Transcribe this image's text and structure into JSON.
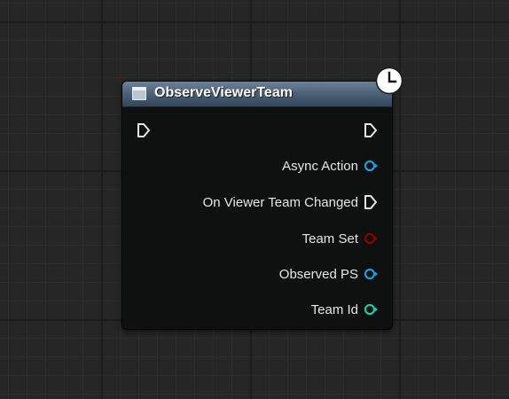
{
  "node": {
    "title": "ObserveViewerTeam",
    "is_latent": true,
    "header_color": "#4e6379",
    "pins": [
      {
        "label": "Async Action",
        "type": "object",
        "color": "#1e9bdc"
      },
      {
        "label": "On Viewer Team Changed",
        "type": "exec",
        "color": "#e6e6e6"
      },
      {
        "label": "Team Set",
        "type": "bool",
        "color": "#8c0000"
      },
      {
        "label": "Observed PS",
        "type": "object",
        "color": "#1e9bdc"
      },
      {
        "label": "Team Id",
        "type": "int",
        "color": "#20c9a4"
      }
    ]
  },
  "icons": {
    "node_icon": "function-node-icon",
    "latent": "clock-icon",
    "exec_in": "exec-input-pin-icon",
    "exec_out": "exec-output-pin-icon"
  }
}
